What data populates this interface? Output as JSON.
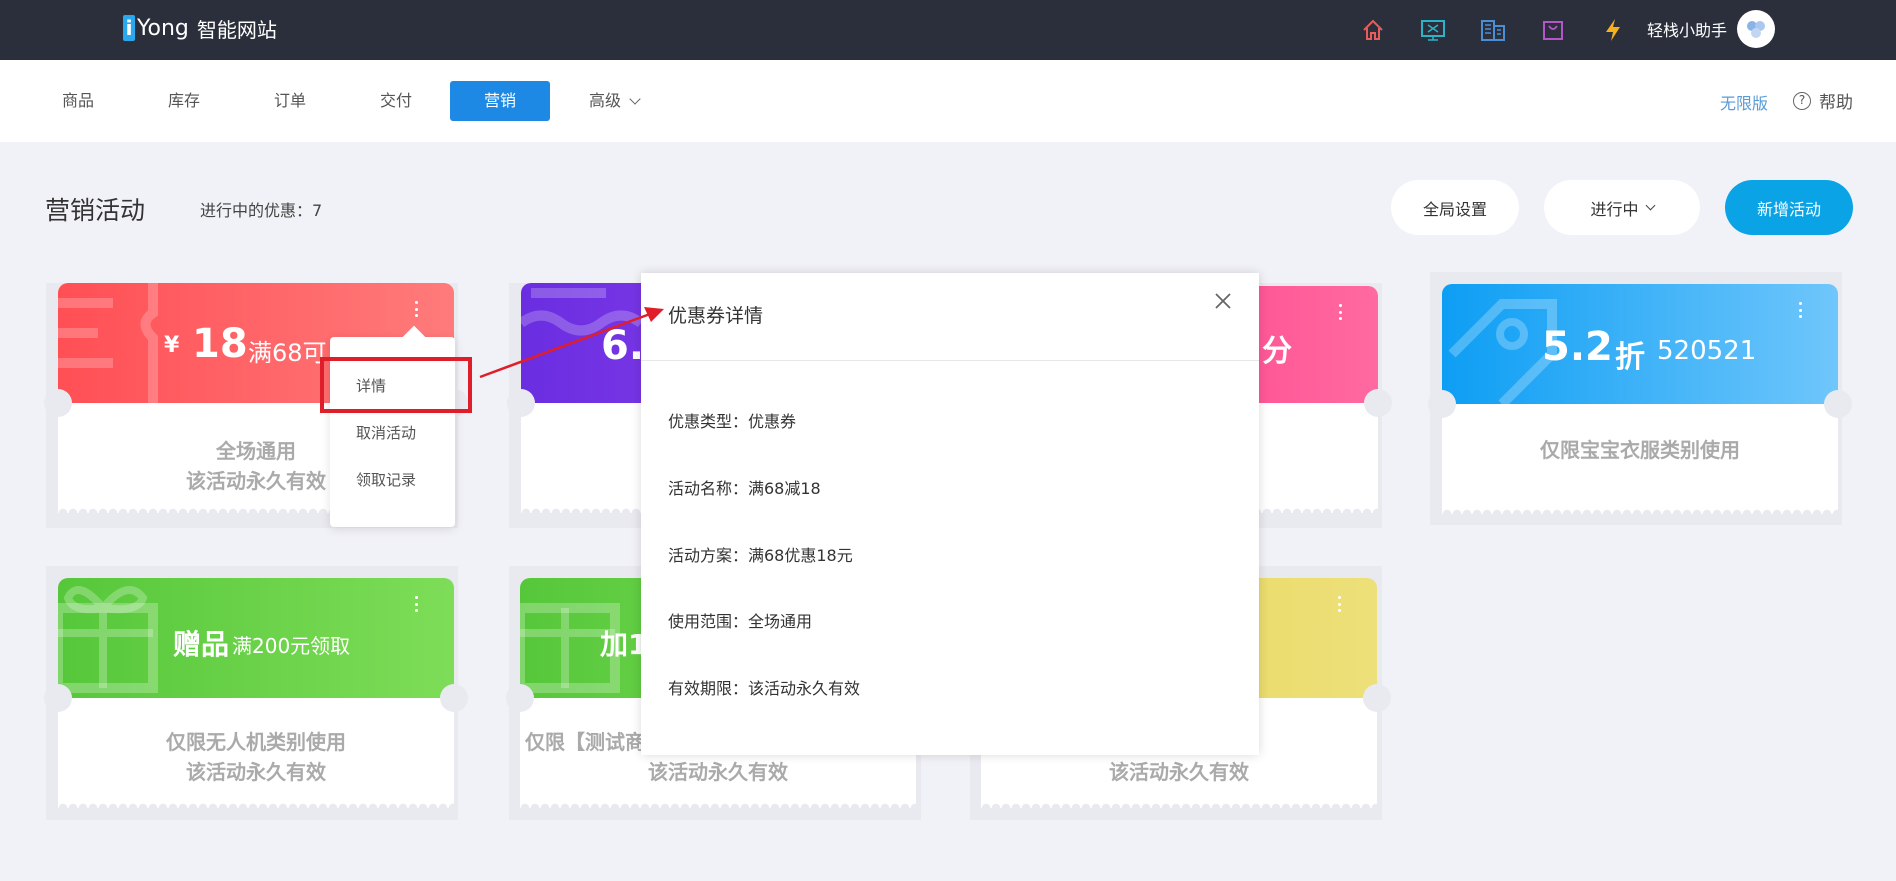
{
  "topbar": {
    "logo_i": "i",
    "logo_brand": "Yong",
    "logo_sub": "智能网站",
    "icons": [
      "home-icon",
      "monitor-icon",
      "building-icon",
      "bag-icon",
      "lightning-icon"
    ],
    "username": "轻栈小助手"
  },
  "nav": {
    "tabs": [
      {
        "label": "商品"
      },
      {
        "label": "库存"
      },
      {
        "label": "订单"
      },
      {
        "label": "交付"
      },
      {
        "label": "营销"
      },
      {
        "label": "高级"
      }
    ],
    "active_tab": "营销",
    "edition": "无限版",
    "help": "帮助",
    "help_glyph": "?"
  },
  "page": {
    "title": "营销活动",
    "active_count": "进行中的优惠：7",
    "global_settings": "全局设置",
    "status_filter": "进行中",
    "new_activity": "新增活动"
  },
  "cards": [
    {
      "currency": "¥",
      "amount": "18",
      "label": "满68可",
      "line1": "全场通用",
      "line2": "该活动永久有效",
      "color_a": "#ff5a5a",
      "color_b": "#ff7a7a"
    },
    {
      "amount": "6.",
      "line1": "",
      "line2": "",
      "color_a": "#6a2de0",
      "color_b": "#8e44ee"
    },
    {
      "amount": "分",
      "line2": ")",
      "color_a": "#ff3a86",
      "color_b": "#ff6aa0"
    },
    {
      "amount": "5.2",
      "unit": "折",
      "code": "520521",
      "line1": "仅限宝宝衣服类别使用",
      "color_a": "#1aa3f5",
      "color_b": "#6cc4fb"
    },
    {
      "amount": "赠品",
      "label": "满200元领取",
      "line1": "仅限无人机类别使用",
      "line2": "该活动永久有效",
      "color_a": "#5ccc3d",
      "color_b": "#7ade54"
    },
    {
      "amount": "加1",
      "line1": "仅限【测试商",
      "line2": "该活动永久有效",
      "color_a": "#5ccc3d",
      "color_b": "#7ade54"
    },
    {
      "line2": "该活动永久有效",
      "color_a": "#e8d659",
      "color_b": "#efe07a"
    }
  ],
  "menu": {
    "items": [
      "详情",
      "取消活动",
      "领取记录"
    ]
  },
  "modal": {
    "title": "优惠券详情",
    "rows": [
      "优惠类型：优惠券",
      "活动名称：满68减18",
      "活动方案：满68优惠18元",
      "使用范围：全场通用",
      "有效期限：该活动永久有效"
    ]
  }
}
